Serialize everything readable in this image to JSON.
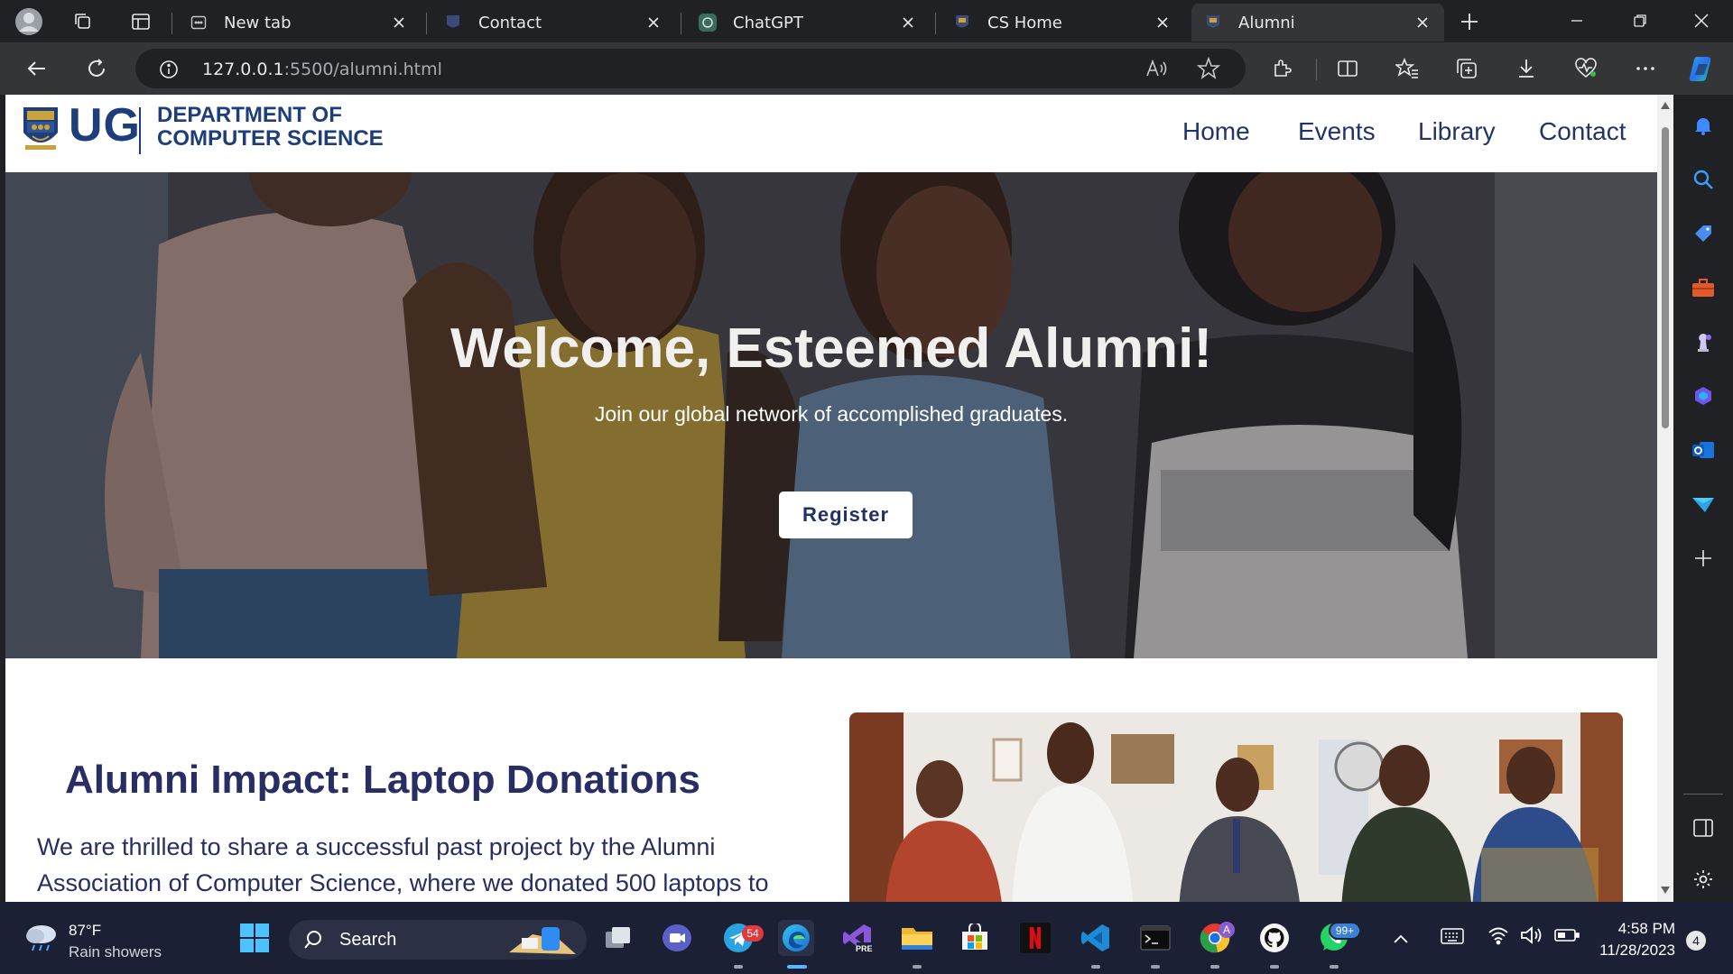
{
  "browser": {
    "tabs": [
      {
        "title": "New tab",
        "icon": "new-tab-icon",
        "active": false
      },
      {
        "title": "Contact",
        "icon": "ug-crest-icon",
        "active": false
      },
      {
        "title": "ChatGPT",
        "icon": "chatgpt-icon",
        "active": false
      },
      {
        "title": "CS Home",
        "icon": "ug-crest-icon",
        "active": false
      },
      {
        "title": "Alumni",
        "icon": "ug-crest-icon",
        "active": true
      }
    ],
    "url_host": "127.0.0.1",
    "url_path": ":5500/alumni.html"
  },
  "site": {
    "logo_text": "UG",
    "dept_line1": "DEPARTMENT OF",
    "dept_line2": "COMPUTER SCIENCE",
    "nav": [
      "Home",
      "Events",
      "Library",
      "Contact"
    ],
    "hero": {
      "title": "Welcome, Esteemed Alumni!",
      "subtitle": "Join our global network of accomplished graduates.",
      "button": "Register"
    },
    "impact": {
      "title": "Alumni Impact: Laptop Donations",
      "text": "We are thrilled to share a successful past project by the Alumni Association of Computer Science, where we donated 500 laptops to"
    }
  },
  "taskbar": {
    "weather_temp": "87°F",
    "weather_desc": "Rain showers",
    "search_label": "Search",
    "telegram_badge": "54",
    "whatsapp_badge": "99+",
    "time": "4:58 PM",
    "date": "11/28/2023",
    "notification_count": "4"
  },
  "colors": {
    "brand_navy": "#1d3e7b",
    "heading_navy": "#282d63",
    "browser_dark": "#202124",
    "taskbar": "#1b2034"
  }
}
